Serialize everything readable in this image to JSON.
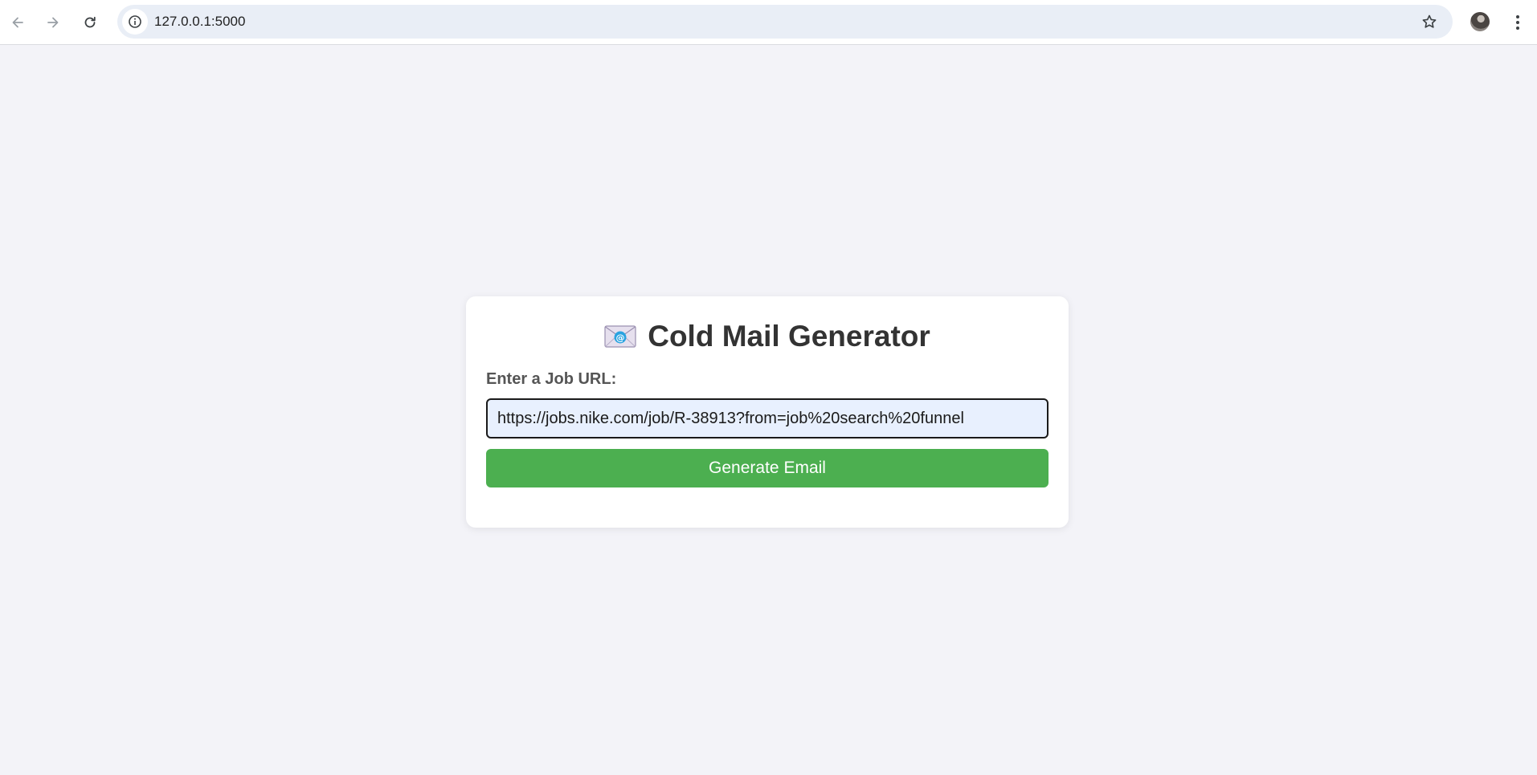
{
  "browser": {
    "url": "127.0.0.1:5000",
    "icons": {
      "back": "back-arrow-icon",
      "forward": "forward-arrow-icon",
      "reload": "reload-icon",
      "site_info": "info-icon",
      "bookmark": "star-icon",
      "profile": "avatar",
      "menu": "kebab-menu-icon"
    }
  },
  "app": {
    "title": "Cold Mail Generator",
    "title_icon": "envelope-icon",
    "form": {
      "label": "Enter a Job URL:",
      "input_value": "https://jobs.nike.com/job/R-38913?from=job%20search%20funnel",
      "button_label": "Generate Email"
    },
    "colors": {
      "button": "#4caf50",
      "background": "#f3f3f8",
      "input_background": "#e8f0fe"
    }
  }
}
